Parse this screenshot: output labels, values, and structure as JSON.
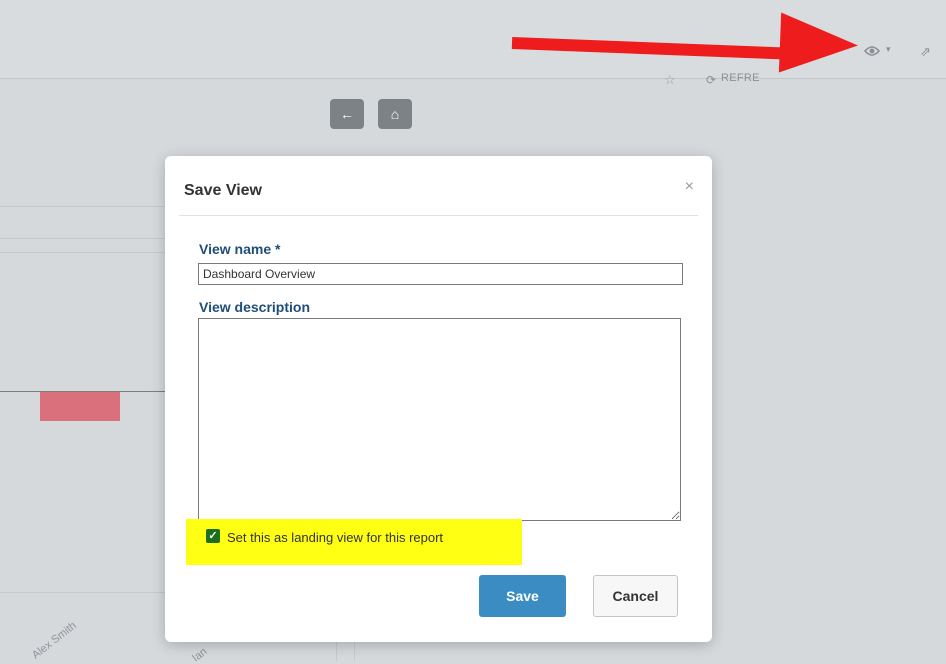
{
  "toolbar": {
    "star_icon": "star-icon",
    "refresh_icon": "refresh-icon",
    "refresh_label": "REFRE",
    "eye_icon": "eye-icon",
    "caret": "▾",
    "share_icon": "share-icon"
  },
  "nav": {
    "back_icon": "←",
    "home_icon": "⌂"
  },
  "background_chart": {
    "labels": [
      "Alex Smith",
      "Ian"
    ],
    "bar_color": "#d9707c"
  },
  "modal": {
    "title": "Save View",
    "close": "×",
    "view_name_label": "View name *",
    "view_name_value": "Dashboard Overview",
    "view_description_label": "View description",
    "view_description_value": "",
    "landing_checkbox_checked": true,
    "landing_checkbox_label": "Set this as landing view for this report",
    "save_label": "Save",
    "cancel_label": "Cancel"
  },
  "annotation": {
    "arrow_color": "#ee1c1c",
    "highlight_color": "#ffff14"
  }
}
